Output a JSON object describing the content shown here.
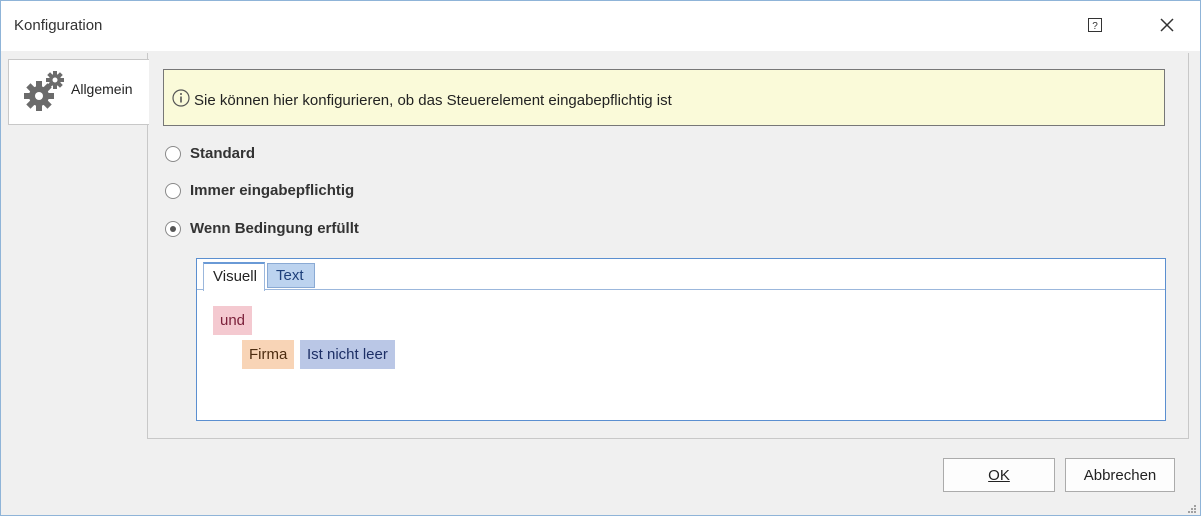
{
  "window": {
    "title": "Konfiguration",
    "help_icon": "help-icon",
    "close_icon": "close-icon"
  },
  "sidebar": {
    "tabs": [
      {
        "label": "Allgemein",
        "icon": "gears-icon",
        "selected": true
      }
    ]
  },
  "info": {
    "icon": "info-icon",
    "text": "Sie können hier konfigurieren, ob das Steuerelement eingabepflichtig ist"
  },
  "options": [
    {
      "label": "Standard",
      "selected": false
    },
    {
      "label": "Immer eingabepflichtig",
      "selected": false
    },
    {
      "label": "Wenn Bedingung erfüllt",
      "selected": true
    }
  ],
  "condition_editor": {
    "tabs": [
      {
        "label": "Visuell",
        "active": true
      },
      {
        "label": "Text",
        "active": false
      }
    ],
    "operator": "und",
    "field": "Firma",
    "comparison": "Ist nicht leer"
  },
  "buttons": {
    "ok": "OK",
    "cancel": "Abbrechen"
  },
  "colors": {
    "info_background": "#fafad9",
    "operator_chip": "#f4c9d0",
    "field_chip": "#f8d4b6",
    "comparison_chip": "#bac7e6",
    "active_tab_accent": "#6a9ad6"
  }
}
